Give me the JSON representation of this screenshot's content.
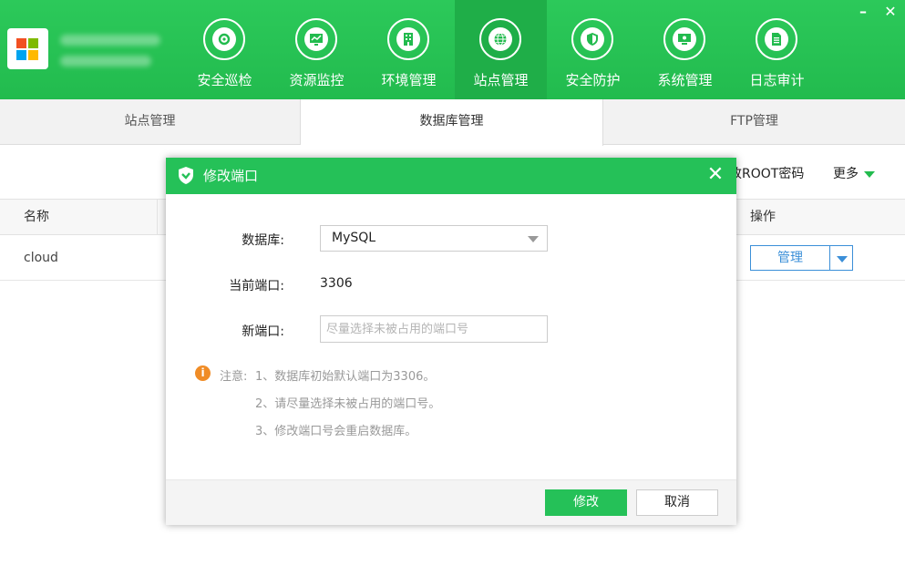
{
  "window": {
    "minimize_label": "–",
    "close_label": "✕"
  },
  "logo": {
    "icon": "windows-logo-icon"
  },
  "nav": [
    {
      "label": "安全巡检",
      "icon": "inspection-icon"
    },
    {
      "label": "资源监控",
      "icon": "monitor-chart-icon"
    },
    {
      "label": "环境管理",
      "icon": "building-icon"
    },
    {
      "label": "站点管理",
      "icon": "globe-icon",
      "active": true
    },
    {
      "label": "安全防护",
      "icon": "shield-icon"
    },
    {
      "label": "系统管理",
      "icon": "desktop-icon"
    },
    {
      "label": "日志审计",
      "icon": "document-icon"
    }
  ],
  "tabs": {
    "site": "站点管理",
    "database": "数据库管理",
    "ftp": "FTP管理"
  },
  "toolbar": {
    "root_password": "改ROOT密码",
    "more": "更多"
  },
  "table": {
    "columns": {
      "name": "名称",
      "operation": "操作"
    },
    "rows": [
      {
        "name": "cloud",
        "action": "管理"
      }
    ]
  },
  "modal": {
    "title": "修改端口",
    "close": "✕",
    "database_label": "数据库:",
    "database_value": "MySQL",
    "current_port_label": "当前端口:",
    "current_port_value": "3306",
    "new_port_label": "新端口:",
    "new_port_placeholder": "尽量选择未被占用的端口号",
    "notice_label": "注意:",
    "notices": [
      "1、数据库初始默认端口为3306。",
      "2、请尽量选择未被占用的端口号。",
      "3、修改端口号会重启数据库。"
    ],
    "confirm": "修改",
    "cancel": "取消"
  },
  "colors": {
    "brand": "#25c158",
    "accent_blue": "#3b8fd8",
    "warning": "#f08c26"
  }
}
